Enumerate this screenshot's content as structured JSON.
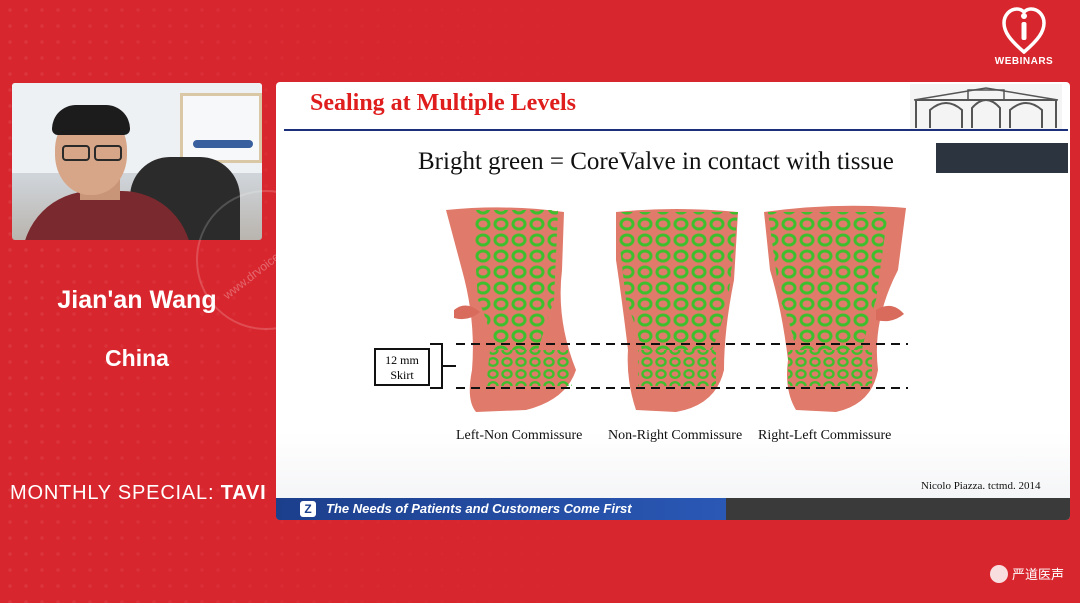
{
  "logo": {
    "label": "WEBINARS"
  },
  "speaker": {
    "name": "Jian'an Wang",
    "country": "China"
  },
  "program": {
    "prefix": "MONTHLY SPECIAL:",
    "topic": "TAVI"
  },
  "watermark": {
    "text": "www.drvoice.cn"
  },
  "slide": {
    "title": "Sealing at Multiple Levels",
    "subtitle": "Bright green = CoreValve in contact with tissue",
    "skirt_label": [
      "12 mm",
      "Skirt"
    ],
    "captions": [
      "Left-Non Commissure",
      "Non-Right Commissure",
      "Right-Left Commissure"
    ],
    "citation": "Nicolo Piazza. tctmd. 2014",
    "footer_text": "The Needs of Patients and Customers Come First"
  },
  "brand": {
    "text": "严道医声"
  },
  "colors": {
    "background": "#d8262e",
    "slide_title": "#e01d1d",
    "valve_green": "#3fbf2e",
    "tissue": "#e07a6a",
    "footer_blue": "#1c3f8c"
  }
}
